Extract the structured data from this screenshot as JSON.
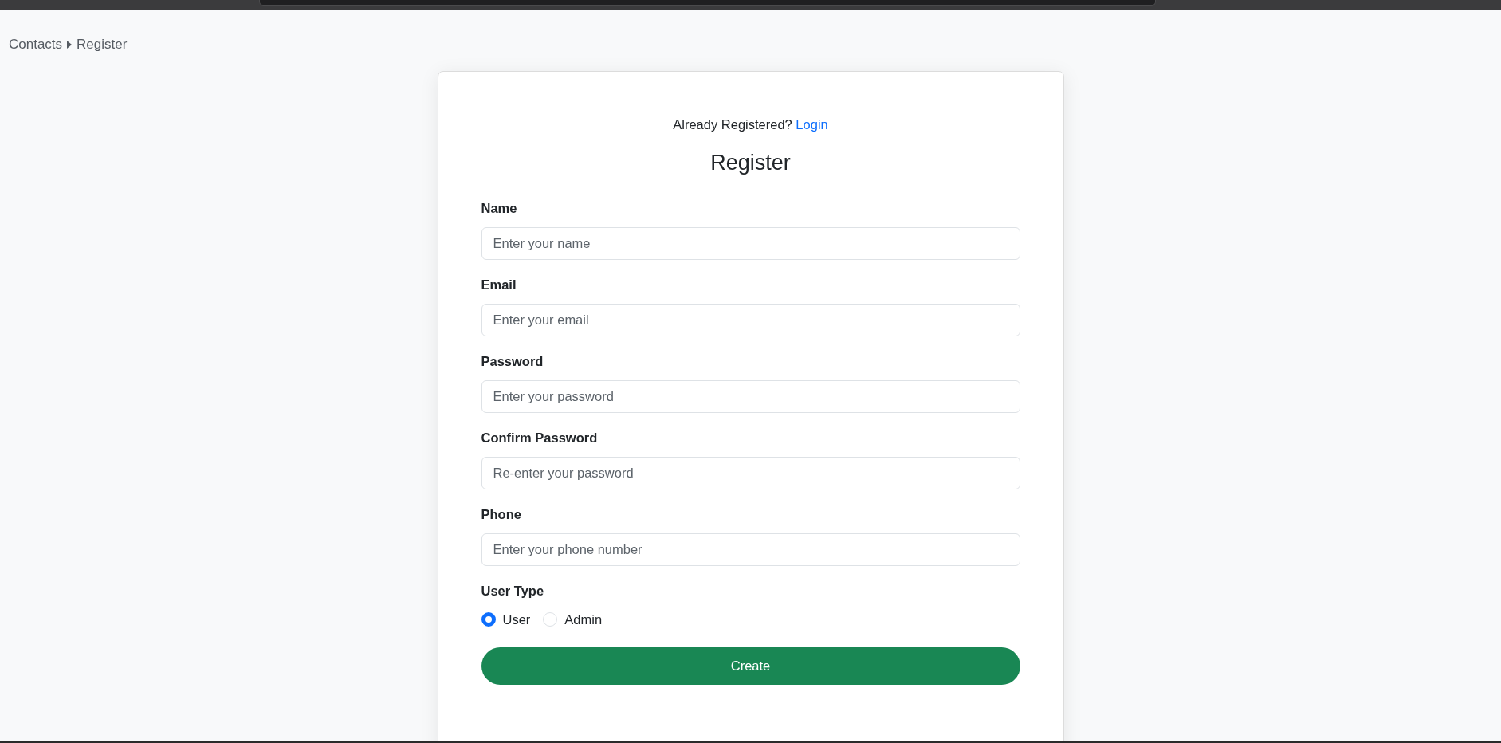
{
  "breadcrumb": [
    {
      "label": "Contacts"
    },
    {
      "label": "Register"
    }
  ],
  "login_prompt": {
    "text": "Already Registered?",
    "link": "Login"
  },
  "title": "Register",
  "fields": [
    {
      "label": "Name",
      "placeholder": "Enter your name"
    },
    {
      "label": "Email",
      "placeholder": "Enter your email"
    },
    {
      "label": "Password",
      "placeholder": "Enter your password"
    },
    {
      "label": "Confirm Password",
      "placeholder": "Re-enter your password"
    },
    {
      "label": "Phone",
      "placeholder": "Enter your phone number"
    }
  ],
  "user_type": {
    "label": "User Type",
    "options": [
      {
        "label": "User",
        "selected": true
      },
      {
        "label": "Admin",
        "selected": false
      }
    ]
  },
  "submit_button": "Create"
}
